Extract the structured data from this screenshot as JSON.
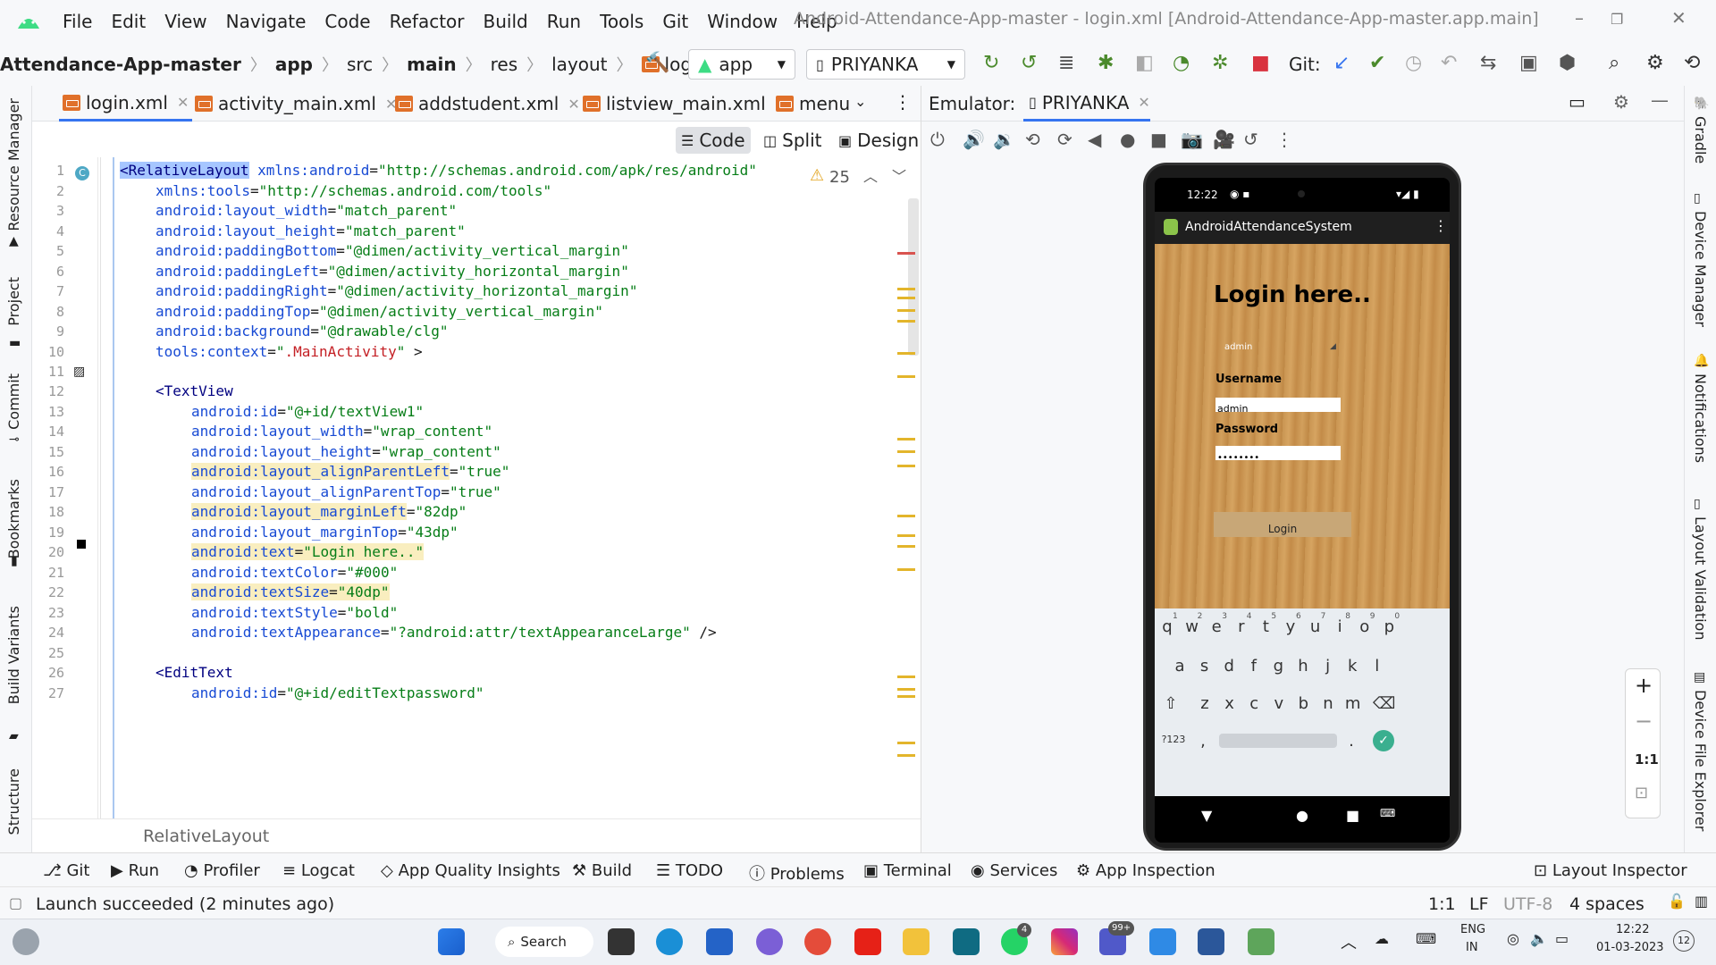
{
  "menubar": {
    "items": [
      "File",
      "Edit",
      "View",
      "Navigate",
      "Code",
      "Refactor",
      "Build",
      "Run",
      "Tools",
      "Git",
      "Window",
      "Help"
    ],
    "window_title": "Android-Attendance-App-master - login.xml [Android-Attendance-App-master.app.main]"
  },
  "navbar": {
    "breadcrumbs": [
      "Attendance-App-master",
      "app",
      "src",
      "main",
      "res",
      "layout",
      "login.xml"
    ],
    "run_config": "app",
    "device": "PRIYANKA",
    "git_label": "Git:"
  },
  "left_tools": [
    "Resource Manager",
    "Project",
    "Commit",
    "Bookmarks",
    "Build Variants",
    "Structure"
  ],
  "right_tools": [
    "Gradle",
    "Device Manager",
    "Notifications",
    "Layout Validation",
    "Device File Explorer"
  ],
  "tabs": [
    "login.xml",
    "activity_main.xml",
    "addstudent.xml",
    "listview_main.xml",
    "menu"
  ],
  "view_modes": [
    "Code",
    "Split",
    "Design"
  ],
  "editor": {
    "warning_count": "25",
    "breadcrumb": "RelativeLayout",
    "line_numbers": [
      "1",
      "2",
      "3",
      "4",
      "5",
      "6",
      "7",
      "8",
      "9",
      "10",
      "11",
      "12",
      "13",
      "14",
      "15",
      "16",
      "17",
      "18",
      "19",
      "20",
      "21",
      "22",
      "23",
      "24",
      "25",
      "26",
      "27"
    ]
  },
  "emulator": {
    "label": "Emulator:",
    "device_tab": "PRIYANKA",
    "status_time": "12:22",
    "app_title": "AndroidAttendanceSystem",
    "login_heading": "Login here..",
    "spinner_value": "admin",
    "username_label": "Username",
    "username_value": "admin",
    "password_label": "Password",
    "password_value": "••••••••",
    "login_button": "Login",
    "keys_row1": [
      "q",
      "w",
      "e",
      "r",
      "t",
      "y",
      "u",
      "i",
      "o",
      "p"
    ],
    "keys_row1_nums": [
      "1",
      "2",
      "3",
      "4",
      "5",
      "6",
      "7",
      "8",
      "9",
      "0"
    ],
    "keys_row2": [
      "a",
      "s",
      "d",
      "f",
      "g",
      "h",
      "j",
      "k",
      "l"
    ],
    "keys_row3": [
      "z",
      "x",
      "c",
      "v",
      "b",
      "n",
      "m"
    ],
    "key_symbols": "?123",
    "key_comma": ",",
    "key_period": "."
  },
  "zoom": {
    "plus": "+",
    "minus": "−",
    "one_to_one": "1:1"
  },
  "tool_windows": [
    "Git",
    "Run",
    "Profiler",
    "Logcat",
    "App Quality Insights",
    "Build",
    "TODO",
    "Problems",
    "Terminal",
    "Services",
    "App Inspection",
    "Layout Inspector"
  ],
  "status": {
    "message": "Launch succeeded (2 minutes ago)",
    "position": "1:1",
    "line_sep": "LF",
    "encoding": "UTF-8",
    "indent": "4 spaces"
  },
  "taskbar": {
    "search_label": "Search",
    "lang1": "ENG",
    "lang2": "IN",
    "time": "12:22",
    "date": "01-03-2023",
    "whatsapp_badge": "4",
    "teams_badge": "99+",
    "notif_count": "12"
  },
  "colors": {
    "accent": "#3574f0",
    "tag": "#000080",
    "attr": "#174ad4",
    "value": "#067d17",
    "warning": "#e3b52b"
  }
}
